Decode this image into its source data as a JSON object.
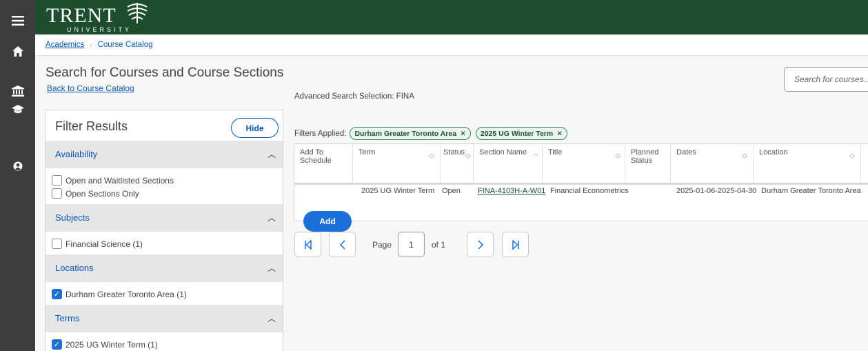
{
  "header": {
    "logo_text": "TRENT",
    "logo_subtext": "UNIVERSITY"
  },
  "breadcrumb": {
    "items": [
      "Academics",
      "Course Catalog"
    ]
  },
  "page": {
    "title": "Search for Courses and Course Sections",
    "back_link": "Back to Course Catalog",
    "search_placeholder": "Search for courses..."
  },
  "filters": {
    "title": "Filter Results",
    "hide_label": "Hide",
    "sections": [
      {
        "label": "Availability",
        "options": [
          {
            "label": "Open and Waitlisted Sections",
            "checked": false
          },
          {
            "label": "Open Sections Only",
            "checked": false
          }
        ]
      },
      {
        "label": "Subjects",
        "options": [
          {
            "label": "Financial Science (1)",
            "checked": false
          }
        ]
      },
      {
        "label": "Locations",
        "options": [
          {
            "label": "Durham Greater Toronto Area (1)",
            "checked": true
          }
        ]
      },
      {
        "label": "Terms",
        "options": [
          {
            "label": "2025 UG Winter Term (1)",
            "checked": true
          }
        ]
      }
    ]
  },
  "results": {
    "advanced_selection": "Advanced Search Selection: FINA",
    "filters_applied_label": "Filters Applied:",
    "chips": [
      "Durham Greater Toronto Area",
      "2025 UG Winter Term"
    ],
    "columns": {
      "add": "Add To Schedule",
      "term": "Term",
      "status": "Status",
      "section": "Section Name",
      "title": "Title",
      "planned": "Planned Status",
      "dates": "Dates",
      "location": "Location"
    },
    "rows": [
      {
        "add_label": "Add",
        "term": "2025 UG Winter Term",
        "status": "Open",
        "section": "FINA-4103H-A-W01",
        "title": "Financial Econometrics",
        "planned": "",
        "dates": "2025-01-06-2025-04-30",
        "location": "Durham Greater Toronto Area"
      }
    ]
  },
  "pager": {
    "page_label": "Page",
    "page_value": "1",
    "of_label": "of 1"
  }
}
